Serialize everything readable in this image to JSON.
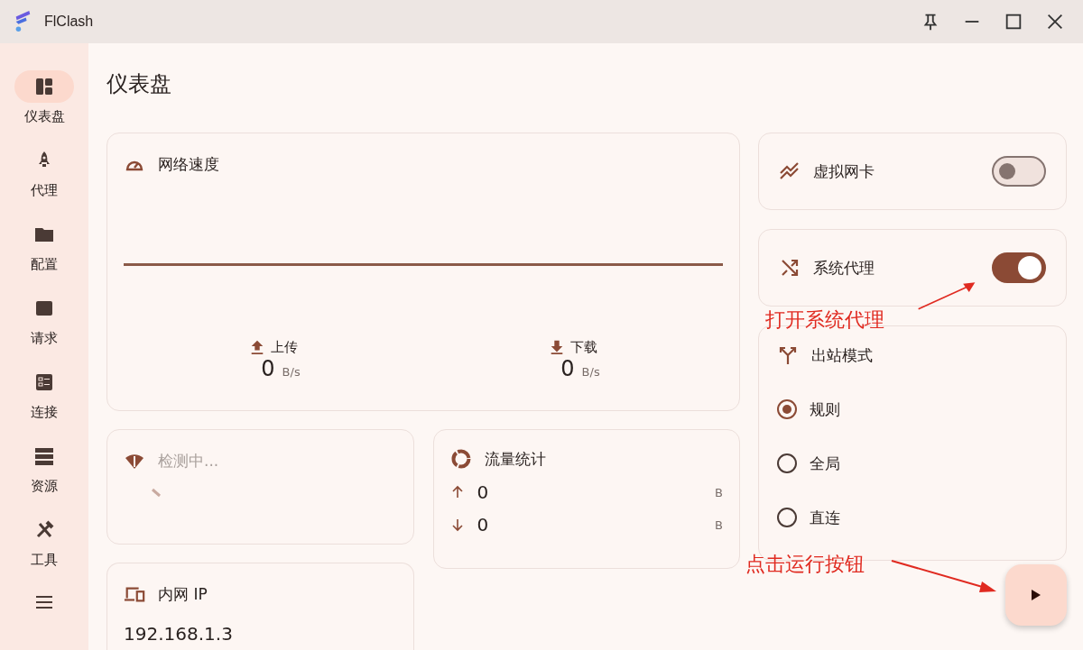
{
  "window": {
    "title": "FlClash"
  },
  "nav": [
    {
      "label": "仪表盘",
      "selected": true
    },
    {
      "label": "代理",
      "selected": false
    },
    {
      "label": "配置",
      "selected": false
    },
    {
      "label": "请求",
      "selected": false
    },
    {
      "label": "连接",
      "selected": false
    },
    {
      "label": "资源",
      "selected": false
    },
    {
      "label": "工具",
      "selected": false
    }
  ],
  "page_title": "仪表盘",
  "speed": {
    "title": "网络速度",
    "stats": [
      {
        "label": "上传",
        "value": "0",
        "unit": "B/s"
      },
      {
        "label": "下载",
        "value": "0",
        "unit": "B/s"
      }
    ]
  },
  "network_check": {
    "status": "检测中..."
  },
  "traffic": {
    "title": "流量统计",
    "rows": [
      {
        "value": "0",
        "unit": "B"
      },
      {
        "value": "0",
        "unit": "B"
      }
    ]
  },
  "lan_ip": {
    "title": "内网 IP",
    "value": "192.168.1.3"
  },
  "toggles": [
    {
      "label": "虚拟网卡",
      "on": false
    },
    {
      "label": "系统代理",
      "on": true
    }
  ],
  "outbound_mode": {
    "title": "出站模式",
    "options": [
      {
        "label": "规则",
        "selected": true
      },
      {
        "label": "全局",
        "selected": false
      },
      {
        "label": "直连",
        "selected": false
      }
    ]
  },
  "annotations": [
    {
      "text": "打开系统代理"
    },
    {
      "text": "点击运行按钮"
    }
  ]
}
